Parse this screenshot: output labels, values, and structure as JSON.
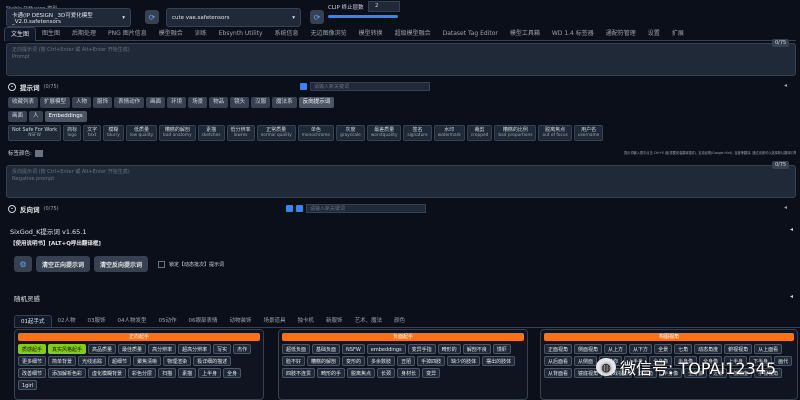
{
  "top": {
    "model": "卡通(IP DESIGN _3D可爱化模型_V2.0.safetensors",
    "vae": "cute vae.safetensors",
    "clip_label": "CLIP 终止层数",
    "clip_value": "2"
  },
  "tabs": [
    "文生图",
    "图生图",
    "后期处理",
    "PNG 图片信息",
    "模型融合",
    "训练",
    "Ebsynth Utility",
    "系统信息",
    "无边图像浏览",
    "模型转换",
    "超级模型融合",
    "Dataset Tag Editor",
    "模型工具箱",
    "WD 1.4 标签器",
    "通配符管理",
    "设置",
    "扩展"
  ],
  "prompt": {
    "placeholder1": "正向提示词 (按 Ctrl+Enter 或 Alt+Enter 开始生成)",
    "placeholder2": "Prompt",
    "count": "0/75"
  },
  "helper": {
    "title": "提示词",
    "count": "(0/75)",
    "checkbox": "",
    "insert_placeholder": "请输入新关键词"
  },
  "cat_tabs": [
    "收藏列表",
    "扩展模型",
    "人物",
    "服饰",
    "表情动作",
    "画面",
    "环境",
    "场景",
    "物品",
    "镜头",
    "汉服",
    "魔法系",
    "反向提示词"
  ],
  "sub_tabs": [
    "画面",
    "人",
    "Embeddings"
  ],
  "tags": [
    [
      "Not Safe For Work",
      "NSFW"
    ],
    [
      "商标",
      "logo"
    ],
    [
      "文字",
      "text"
    ],
    [
      "模糊",
      "blurry"
    ],
    [
      "低质量",
      "low quality"
    ],
    [
      "糟糕的解剖",
      "bad anatomy"
    ],
    [
      "素描",
      "sketches"
    ],
    [
      "低分辨率",
      "lowres"
    ],
    [
      "正常质量",
      "normal quality"
    ],
    [
      "单色",
      "monochrome"
    ],
    [
      "灰度",
      "grayscale"
    ],
    [
      "最差质量",
      "worstquality"
    ],
    [
      "签名",
      "signature"
    ],
    [
      "水印",
      "watermark"
    ],
    [
      "裁剪",
      "cropped"
    ],
    [
      "糟糕的比例",
      "bad proportions"
    ],
    [
      "脱离焦点",
      "out of focus"
    ],
    [
      "用户名",
      "username"
    ]
  ],
  "color_label": "标签颜色:",
  "note": "提示词输入框中点击 Ctrl+E 键(需要安装翻译插件), 支持谷歌(Google Hint), 百度等翻译, 通过设置可以选择默认翻译引擎。",
  "neg": {
    "placeholder1": "反向提示词 (按 Ctrl+Enter 或 Alt+Enter 开始生成)",
    "placeholder2": "Negative prompt",
    "count": "0/75",
    "title": "反向词",
    "helper_count": "(0/75)",
    "insert_placeholder": "请输入新关键词"
  },
  "sixgod": {
    "title": "SixGod_K提示词 v1.65.1",
    "shortcut": "【使用说明书】[ALT+Q呼出翻译框]",
    "btn_clear_pos": "清空正向提示词",
    "btn_clear_neg": "清空反向提示词",
    "lock": "锁定【动态批次】提示词"
  },
  "random": {
    "title": "随机灵感",
    "tabs": [
      "01起手式",
      "02人物",
      "03服饰",
      "04人物发型",
      "05动作",
      "06眼部表情",
      "动物装饰",
      "场景道具",
      "独卡机",
      "新服饰",
      "艺术、魔法",
      "颜色"
    ]
  },
  "col1": {
    "title": "正向起手",
    "tags": [
      [
        "质感起手",
        "g"
      ],
      [
        "真实风格起手",
        "g"
      ],
      [
        "高品质量",
        ""
      ],
      [
        "最佳质量",
        ""
      ],
      [
        "高分辨率",
        ""
      ],
      [
        "超高分辨率",
        ""
      ],
      [
        "写实",
        ""
      ],
      [
        "杰作",
        ""
      ],
      [
        "更多细节",
        ""
      ],
      [
        "简单背景",
        ""
      ],
      [
        "光线追踪",
        ""
      ],
      [
        "超细节",
        ""
      ],
      [
        "聚焦清晰",
        ""
      ],
      [
        "物理渲染",
        ""
      ],
      [
        "极详细的描述",
        ""
      ],
      [
        "改善细节",
        ""
      ],
      [
        "添加解析色彩",
        ""
      ],
      [
        "虚化模糊背景",
        ""
      ],
      [
        "彩色分层",
        ""
      ],
      [
        "扫描",
        ""
      ],
      [
        "素描",
        ""
      ],
      [
        "上半身",
        ""
      ],
      [
        "全身",
        ""
      ],
      [
        "1girl",
        ""
      ]
    ]
  },
  "col2": {
    "title": "负面起手",
    "tags": [
      "超低负面",
      "基础负面",
      "NSFW",
      "embeddings",
      "变异手指",
      "畸形的",
      "解剖不良",
      "馒虾",
      "脸不好",
      "糟糕的解剖",
      "变形的",
      "多余数肢",
      "丑陋",
      "手掉四肢",
      "缺少的肢体",
      "摆出的肢体",
      "四肢不连贯",
      "畸形的手",
      "脱离焦点",
      "长颈",
      "身材长",
      "变异"
    ]
  },
  "col3": {
    "title": "构图视角",
    "tags": [
      "正面视角",
      "侧面视角",
      "从上方",
      "从下方",
      "全景",
      "七角",
      "动态角度",
      "俯视视角",
      "从上面看",
      "从后面看",
      "从侧面",
      "看着你",
      "上半身",
      "全身像",
      "半身像",
      "全身像",
      "上半身",
      "下半身",
      "画代",
      "从背面看",
      "镜底视角",
      "游戏视角",
      "双视角",
      "半身像",
      "全身像",
      "近景",
      "低角度",
      "手视视角"
    ]
  },
  "watermark": "微信号: TOPAI12345"
}
